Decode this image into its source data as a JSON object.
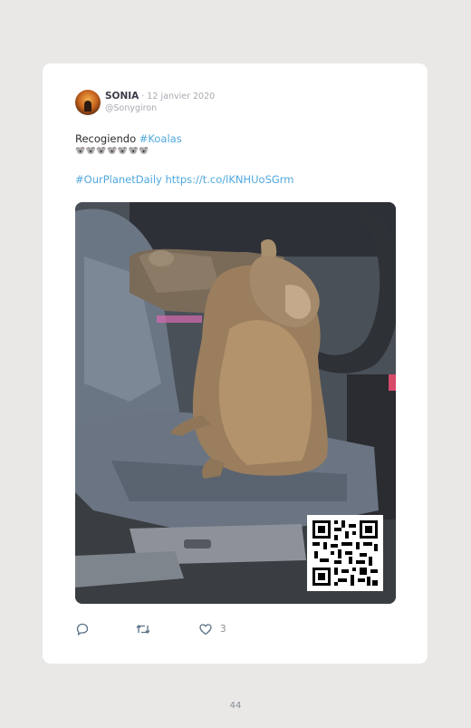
{
  "tweet": {
    "author_name": "SONIA",
    "date": " · 12 janvier 2020",
    "handle": "@Sonygiron",
    "text_prefix": "Recogiendo ",
    "hashtag_koalas": "#Koalas",
    "emoji_line": "🐨🐨🐨🐨🐨🐨🐨",
    "hashtag_planet": "#OurPlanetDaily",
    "link": " https://t.co/lKNHUoSGrm",
    "like_count": "3"
  },
  "page": {
    "number": "44"
  },
  "icons": {
    "reply": "reply-icon",
    "retweet": "retweet-icon",
    "like": "heart-icon",
    "qr": "qr-code"
  },
  "colors": {
    "link": "#4fa8de",
    "background": "#e9e8e6",
    "card": "#ffffff"
  }
}
